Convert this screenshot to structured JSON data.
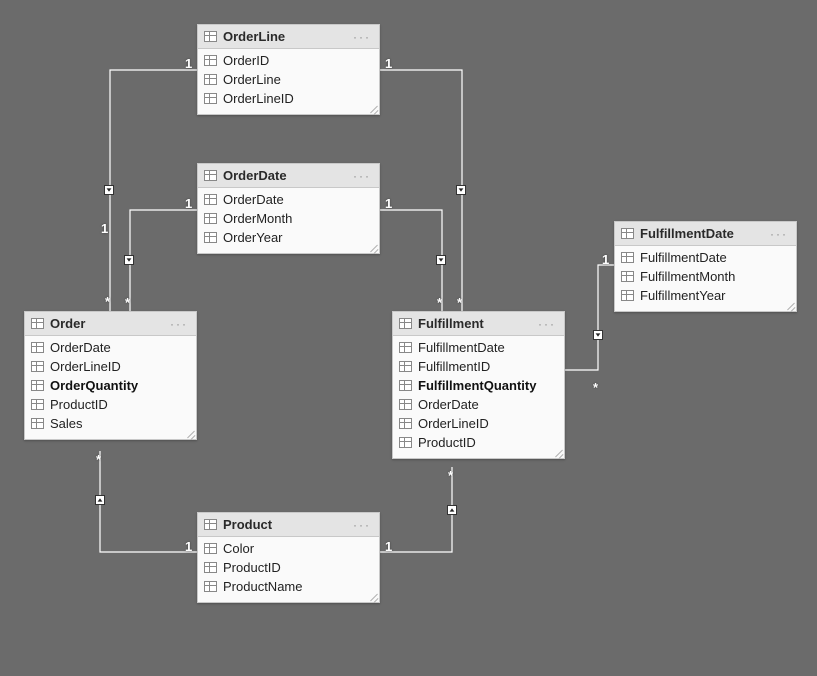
{
  "tables": {
    "orderLine": {
      "title": "OrderLine",
      "fields": [
        "OrderID",
        "OrderLine",
        "OrderLineID"
      ]
    },
    "orderDate": {
      "title": "OrderDate",
      "fields": [
        "OrderDate",
        "OrderMonth",
        "OrderYear"
      ]
    },
    "order": {
      "title": "Order",
      "fields": [
        "OrderDate",
        "OrderLineID",
        "OrderQuantity",
        "ProductID",
        "Sales"
      ]
    },
    "fulfillment": {
      "title": "Fulfillment",
      "fields": [
        "FulfillmentDate",
        "FulfillmentID",
        "FulfillmentQuantity",
        "OrderDate",
        "OrderLineID",
        "ProductID"
      ]
    },
    "product": {
      "title": "Product",
      "fields": [
        "Color",
        "ProductID",
        "ProductName"
      ]
    },
    "fulfillmentDate": {
      "title": "FulfillmentDate",
      "fields": [
        "FulfillmentDate",
        "FulfillmentMonth",
        "FulfillmentYear"
      ]
    }
  },
  "strongFields": {
    "order": "OrderQuantity",
    "fulfillment": "FulfillmentQuantity"
  },
  "relationships": [
    {
      "from": "OrderLine",
      "to": "Order",
      "fromCard": "1",
      "toCard": "*"
    },
    {
      "from": "OrderDate",
      "to": "Order",
      "fromCard": "1",
      "toCard": "*"
    },
    {
      "from": "OrderLine",
      "to": "Fulfillment",
      "fromCard": "1",
      "toCard": "*"
    },
    {
      "from": "OrderDate",
      "to": "Fulfillment",
      "fromCard": "1",
      "toCard": "*"
    },
    {
      "from": "Product",
      "to": "Order",
      "fromCard": "1",
      "toCard": "*"
    },
    {
      "from": "Product",
      "to": "Fulfillment",
      "fromCard": "1",
      "toCard": "*"
    },
    {
      "from": "FulfillmentDate",
      "to": "Fulfillment",
      "fromCard": "1",
      "toCard": "*"
    }
  ],
  "cardLabels": {
    "one": "1",
    "many": "*"
  }
}
